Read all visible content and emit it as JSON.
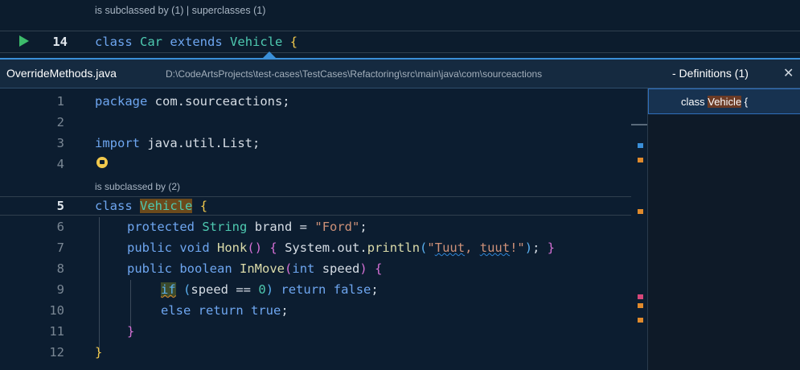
{
  "top_editor": {
    "codelens": "is subclassed by (1) | superclasses (1)",
    "line_number": "14",
    "code": {
      "kw": "class",
      "name1": "Car",
      "kw2": "extends",
      "name2": "Vehicle",
      "brace": "{"
    }
  },
  "peek": {
    "file_name": "OverrideMethods.java",
    "file_path": "D:\\CodeArtsProjects\\test-cases\\TestCases\\Refactoring\\src\\main\\java\\com\\sourceactions",
    "separator_title": "- Definitions (1)",
    "close_label": "✕",
    "reference": {
      "kw": "class",
      "name": "Vehicle",
      "brace": "{"
    }
  },
  "code_lens_inner": "is subclassed by (2)",
  "lines": [
    {
      "n": "1",
      "text": "package com.sourceactions;"
    },
    {
      "n": "2",
      "text": ""
    },
    {
      "n": "3",
      "text": "import java.util.List;"
    },
    {
      "n": "4",
      "text": ""
    },
    {
      "n": "5",
      "text": "class Vehicle {"
    },
    {
      "n": "6",
      "text": "protected String brand = \"Ford\";"
    },
    {
      "n": "7",
      "text": "public void Honk() { System.out.println(\"Tuut, tuut!\"); }"
    },
    {
      "n": "8",
      "text": "public boolean InMove(int speed) {"
    },
    {
      "n": "9",
      "text": "if (speed == 0) return false;"
    },
    {
      "n": "10",
      "text": "else return true;"
    },
    {
      "n": "11",
      "text": "}"
    },
    {
      "n": "12",
      "text": "}"
    }
  ],
  "tokens": {
    "package_kw": "package",
    "package_name": "com.sourceactions;",
    "import_kw": "import",
    "import_name": "java.util.List;",
    "class_kw": "class",
    "class_name": "Vehicle",
    "open_brace": "{",
    "protected_kw": "protected",
    "string_type": "String",
    "brand_text": "brand =",
    "ford_str": "\"Ford\"",
    "semi": ";",
    "public_kw": "public",
    "void_kw": "void",
    "honk_fn": "Honk",
    "paren_open": "(",
    "paren_close": ")",
    "sys_text": "System.out.",
    "println_fn": "println",
    "tuut1": "Tuut",
    "comma": ", ",
    "tuut2": "tuut",
    "tuut_rest": "!\"",
    "q_open": "\"",
    "semi_close": ";",
    "close_brace": "}",
    "boolean_kw": "boolean",
    "inmove_fn": "InMove",
    "int_kw": "int",
    "speed": "speed",
    "if_kw": "if",
    "cond": "speed == ",
    "zero": "0",
    "return_kw": "return",
    "false_kw": "false",
    "else_kw": "else",
    "true_kw": "true"
  },
  "colors": {
    "accent": "#3a8fd8",
    "run_icon": "#3dbb6b",
    "keyword": "#6ea6f0",
    "type": "#4ec9b0",
    "string": "#ce9178"
  }
}
